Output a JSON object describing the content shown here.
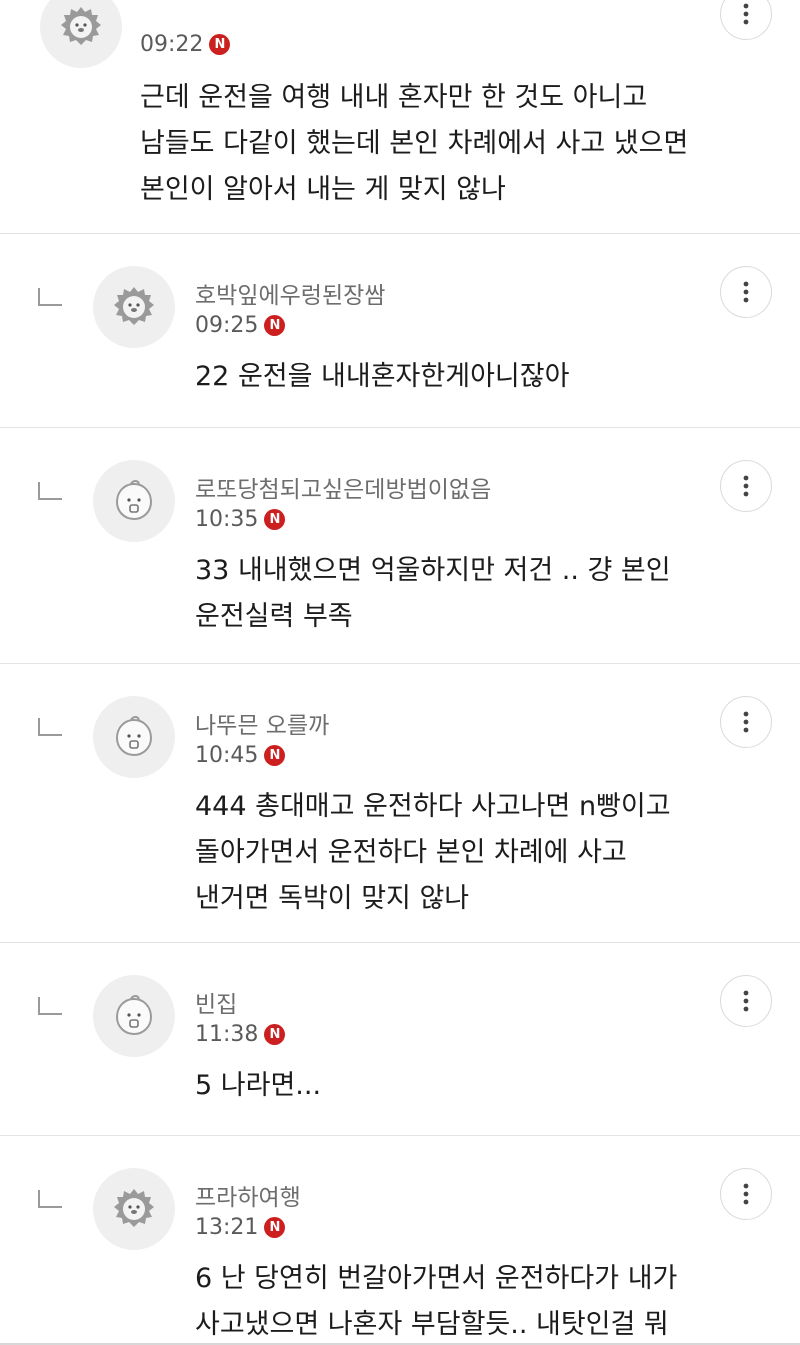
{
  "comments": [
    {
      "author": "",
      "time": "09:22",
      "badge": "N",
      "lines": [
        "근데 운전을 여행 내내 혼자만 한 것도 아니고",
        "남들도 다같이 했는데 본인 차례에서 사고 냈으면",
        "본인이 알아서 내는 게 맞지 않나"
      ],
      "avatar_icon": "lion-avatar-icon"
    },
    {
      "author": "호박잎에우렁된장쌈",
      "time": "09:25",
      "badge": "N",
      "lines": [
        "22 운전을 내내혼자한게아니잖아"
      ],
      "avatar_icon": "lion-avatar-icon"
    },
    {
      "author": "로또당첨되고싶은데방법이없음",
      "time": "10:35",
      "badge": "N",
      "lines": [
        "33 내내했으면 억울하지만 저건 .. 걍 본인",
        "운전실력 부족"
      ],
      "avatar_icon": "peach-avatar-icon"
    },
    {
      "author": "나뚜믄 오를까",
      "time": "10:45",
      "badge": "N",
      "lines": [
        "444 총대매고 운전하다 사고나면 n빵이고",
        "돌아가면서 운전하다 본인 차례에 사고",
        "낸거면 독박이 맞지 않나"
      ],
      "avatar_icon": "peach-avatar-icon"
    },
    {
      "author": "빈집",
      "time": "11:38",
      "badge": "N",
      "lines": [
        "5 나라면..."
      ],
      "avatar_icon": "peach-avatar-icon"
    },
    {
      "author": "프라하여행",
      "time": "13:21",
      "badge": "N",
      "lines": [
        "6 난 당연히 번갈아가면서 운전하다가 내가",
        "사고냈으면 나혼자 부담할듯.. 내탓인걸 뭐"
      ],
      "avatar_icon": "lion-avatar-icon"
    }
  ],
  "colors": {
    "badge": "#cc1f1f",
    "author": "#6d6d6d",
    "divider": "#e3e3e3"
  }
}
